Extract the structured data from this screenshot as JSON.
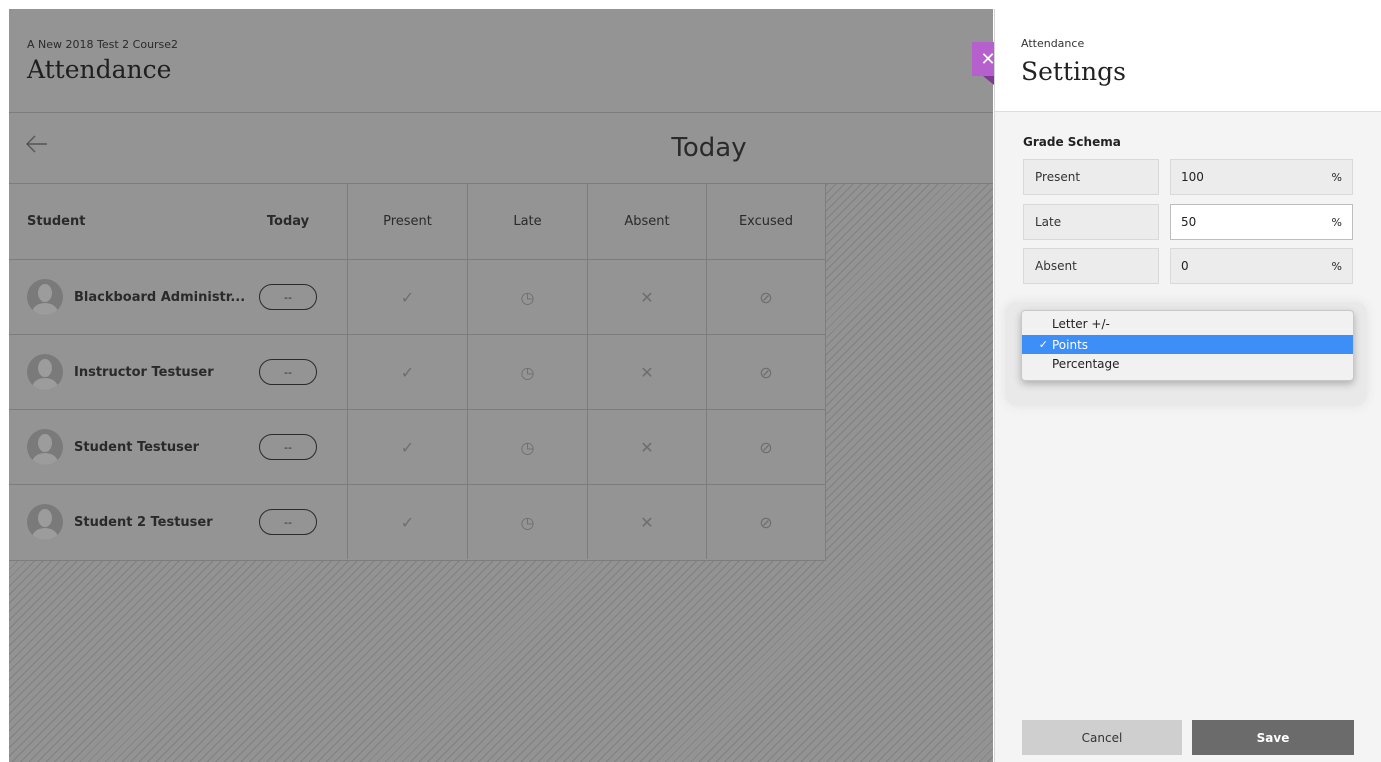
{
  "course": {
    "name": "A New 2018 Test 2 Course2",
    "title": "Attendance"
  },
  "date_bar": {
    "back_icon": "arrow-left-icon",
    "title": "Today"
  },
  "grid": {
    "headers": {
      "student": "Student",
      "today": "Today",
      "present": "Present",
      "late": "Late",
      "absent": "Absent",
      "excused": "Excused"
    },
    "rows": [
      {
        "name": "Blackboard Administr...",
        "status": "--"
      },
      {
        "name": "Instructor Testuser",
        "status": "--"
      },
      {
        "name": "Student Testuser",
        "status": "--"
      },
      {
        "name": "Student 2 Testuser",
        "status": "--"
      }
    ],
    "marks": {
      "present": "✓",
      "late": "◷",
      "absent": "✕",
      "excused": "⊘"
    }
  },
  "panel": {
    "close_glyph": "✕",
    "subtitle": "Attendance",
    "title": "Settings",
    "schema_label": "Grade Schema",
    "schema": [
      {
        "label": "Present",
        "value": "100",
        "unit": "%"
      },
      {
        "label": "Late",
        "value": "50",
        "unit": "%"
      },
      {
        "label": "Absent",
        "value": "0",
        "unit": "%"
      }
    ],
    "dropdown": {
      "options": [
        {
          "label": "Letter +/-",
          "check": ""
        },
        {
          "label": "Points",
          "check": "✓"
        },
        {
          "label": "Percentage",
          "check": ""
        }
      ],
      "selected": "Points"
    },
    "cancel_label": "Cancel",
    "save_label": "Save"
  },
  "colors": {
    "accent": "#b560cc",
    "selection": "#3d8ef7",
    "save_button": "#6b6b6b",
    "overlay": "#939393"
  }
}
